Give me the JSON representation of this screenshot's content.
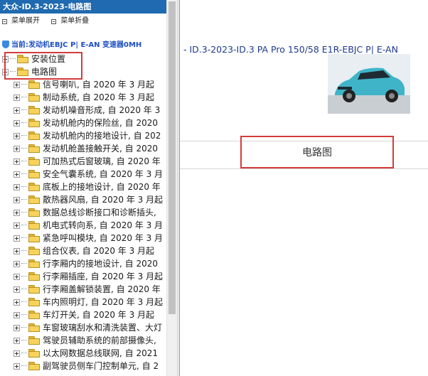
{
  "left_panel": {
    "title": "大众-ID.3-2023-电路图",
    "menu": {
      "expand_label": "菜单展开",
      "collapse_label": "菜单折叠"
    },
    "current_path": "当前:发动机EBJC P| E-AN 变速器0MH",
    "tree_top": [
      {
        "label": "安装位置"
      },
      {
        "label": "电路图"
      }
    ],
    "tree_items": [
      {
        "label": "信号喇叭, 自 2020 年 3 月起"
      },
      {
        "label": "制动系统, 自 2020 年 3 月起"
      },
      {
        "label": "发动机噪音形成, 自 2020 年 3"
      },
      {
        "label": "发动机舱内的保险丝, 自 2020"
      },
      {
        "label": "发动机舱内的接地设计, 自 202"
      },
      {
        "label": "发动机舱盖接触开关, 自 2020"
      },
      {
        "label": "可加热式后窗玻璃, 自 2020 年"
      },
      {
        "label": "安全气囊系统, 自 2020 年 3 月"
      },
      {
        "label": "底板上的接地设计, 自 2020 年"
      },
      {
        "label": "散热器风扇, 自 2020 年 3 月起"
      },
      {
        "label": "数据总线诊断接口和诊断插头,"
      },
      {
        "label": "机电式转向系, 自 2020 年 3 月"
      },
      {
        "label": "紧急呼叫模块, 自 2020 年 3 月"
      },
      {
        "label": "组合仪表, 自 2020 年 3 月起"
      },
      {
        "label": "行李厢内的接地设计, 自 2020"
      },
      {
        "label": "行李厢插座, 自 2020 年 3 月起"
      },
      {
        "label": "行李厢盖解锁装置, 自 2020 年"
      },
      {
        "label": "车内照明灯, 自 2020 年 3 月起"
      },
      {
        "label": "车灯开关, 自 2020 年 3 月起"
      },
      {
        "label": "车窗玻璃刮水和清洗装置、大灯"
      },
      {
        "label": "驾驶员辅助系统的前部摄像头,"
      },
      {
        "label": "以太网数据总线联网, 自 2021"
      },
      {
        "label": "副驾驶员侧车门控制单元, 自 2"
      }
    ]
  },
  "right_panel": {
    "vehicle_line": "- ID.3-2023-ID.3 PA Pro 150/58 E1R-EBJC P| E-AN",
    "diagram_link_label": "电路图"
  },
  "colors": {
    "title_bar": "#1f6ab0",
    "highlight_border": "#d43b3b",
    "link_blue": "#1e3a8c"
  }
}
